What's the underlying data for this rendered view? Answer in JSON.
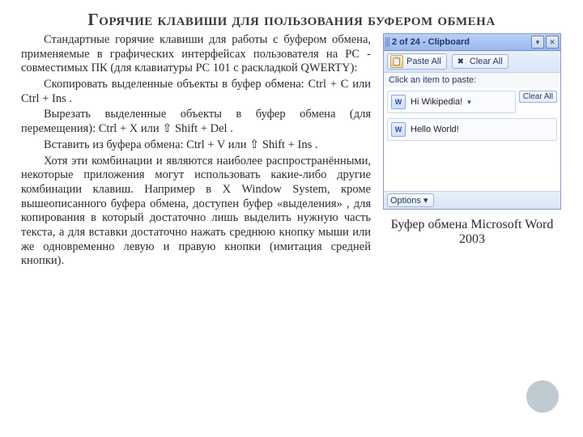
{
  "title": "Горячие клавиши для пользования буфером обмена",
  "paragraphs": {
    "p1": "Стандартные горячие клавиши для работы с буфером обмена, применяемые в графических интерфейсах пользователя на PC - совместимых ПК (для клавиатуры PC 101 с раскладкой QWERTY):",
    "p2": "Скопировать выделенные объекты в буфер обмена:  Ctrl  +  C  или  Ctrl  +  Ins .",
    "p3": "Вырезать выделенные объекты в буфер обмена (для перемещения):  Ctrl  +  X  или  ⇧ Shift  +  Del .",
    "p4": "Вставить из буфера обмена:  Ctrl  +  V  или  ⇧ Shift  +  Ins .",
    "p5": "Хотя эти комбинации и являются наиболее распространёнными, некоторые приложения могут использовать какие-либо другие комбинации клавиш. Например в X Window System, кроме вышеописанного буфера обмена, доступен буфер «выделения» , для копирования в который достаточно лишь выделить нужную часть текста, а для вставки достаточно нажать среднюю кнопку мыши или же одновременно левую и правую кнопки (имитация средней кнопки)."
  },
  "clipboard": {
    "windowTitle": "2 of 24 - Clipboard",
    "pasteAll": "Paste All",
    "clearAllTop": "Clear All",
    "hint": "Click an item to paste:",
    "item1": "Hi Wikipedia!",
    "item2": "Hello World!",
    "clearAllSide": "Clear All",
    "options": "Options ▾"
  },
  "caption": "Буфер обмена Microsoft Word 2003"
}
